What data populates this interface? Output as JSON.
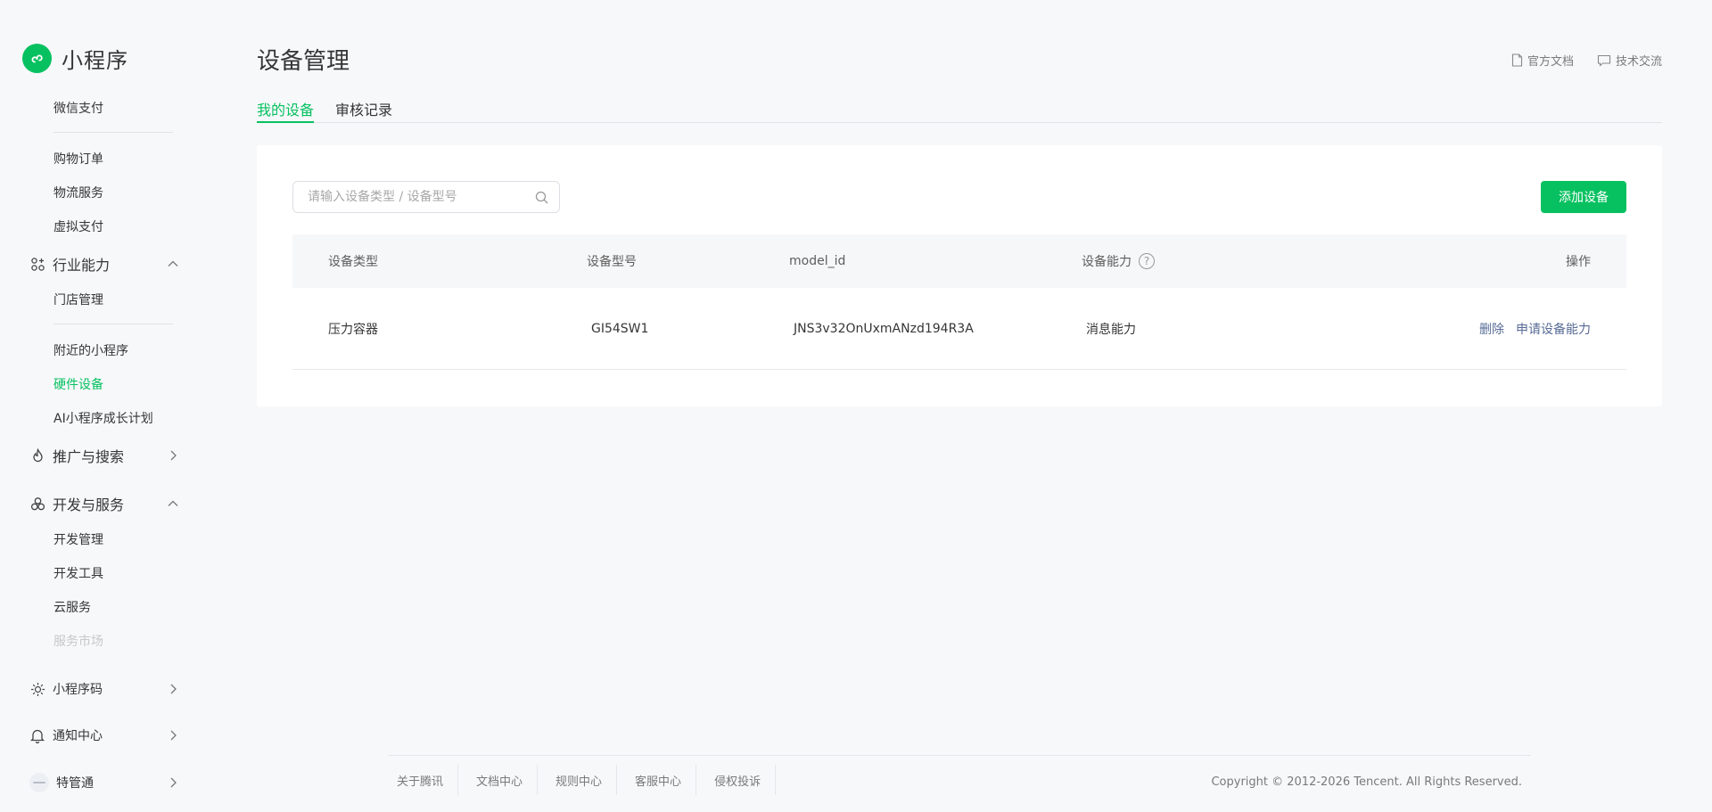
{
  "brand": {
    "name": "小程序"
  },
  "sidebar": {
    "items": [
      {
        "label": "微信支付"
      },
      {
        "label": "购物订单"
      },
      {
        "label": "物流服务"
      },
      {
        "label": "虚拟支付"
      },
      {
        "label": "行业能力"
      },
      {
        "label": "门店管理"
      },
      {
        "label": "附近的小程序"
      },
      {
        "label": "硬件设备"
      },
      {
        "label": "AI小程序成长计划"
      },
      {
        "label": "推广与搜索"
      },
      {
        "label": "开发与服务"
      },
      {
        "label": "开发管理"
      },
      {
        "label": "开发工具"
      },
      {
        "label": "云服务"
      },
      {
        "label": "服务市场"
      },
      {
        "label": "小程序码"
      },
      {
        "label": "通知中心"
      },
      {
        "label": "特管通"
      }
    ]
  },
  "header": {
    "title": "设备管理",
    "links": {
      "docs": "官方文档",
      "community": "技术交流"
    }
  },
  "tabs": [
    {
      "label": "我的设备"
    },
    {
      "label": "审核记录"
    }
  ],
  "toolbar": {
    "search_placeholder": "请输入设备类型 / 设备型号",
    "add_label": "添加设备"
  },
  "table": {
    "columns": [
      "设备类型",
      "设备型号",
      "model_id",
      "设备能力",
      "操作"
    ],
    "rows": [
      {
        "type": "压力容器",
        "model": "GI54SW1",
        "model_id": "JNS3v32OnUxmANzd194R3A",
        "capability": "消息能力",
        "actions": {
          "delete": "删除",
          "apply": "申请设备能力"
        }
      }
    ]
  },
  "footer": {
    "links": [
      "关于腾讯",
      "文档中心",
      "规则中心",
      "客服中心",
      "侵权投诉"
    ],
    "copyright": "Copyright © 2012-2026 Tencent. All Rights Reserved."
  },
  "colors": {
    "accent": "#07c160",
    "link": "#576b95",
    "text": "#353535",
    "background": "#f7f8fa"
  }
}
